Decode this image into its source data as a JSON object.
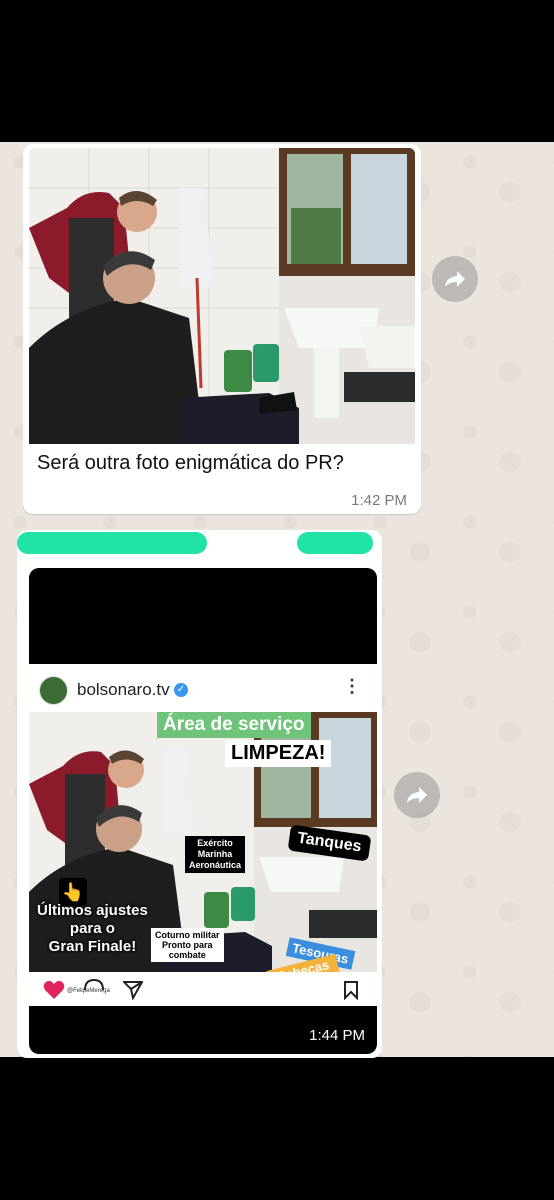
{
  "messages": [
    {
      "caption": "Será outra foto enigmática do PR?",
      "time": "1:42 PM"
    },
    {
      "time": "1:44 PM",
      "post": {
        "username": "bolsonaro.tv",
        "credit": "@FelipeMerega",
        "overlay": {
          "area": "Área de serviço",
          "limpeza": "LIMPEZA!",
          "tanques": "Tanques",
          "exercito": "Exército\nMarinha\nAeronáutica",
          "ultimos": "Últimos ajustes\npara o\nGran Finale!",
          "coturno": "Coturno militar\nPronto para\ncombate",
          "tesouras": "Tesouras",
          "cabecas": "Cabeças\nvão rolar!"
        }
      }
    }
  ],
  "icons": {
    "forward": "forward-arrow-icon",
    "heart": "heart-icon",
    "comment": "comment-icon",
    "share": "share-icon",
    "bookmark": "bookmark-icon",
    "more": "more-options-icon",
    "verified": "verified-badge-icon"
  },
  "colors": {
    "chat_background": "#ece5dd",
    "bubble": "#ffffff",
    "redaction": "#22e3a6",
    "verified": "#3897f0",
    "heart": "#e0245e"
  }
}
